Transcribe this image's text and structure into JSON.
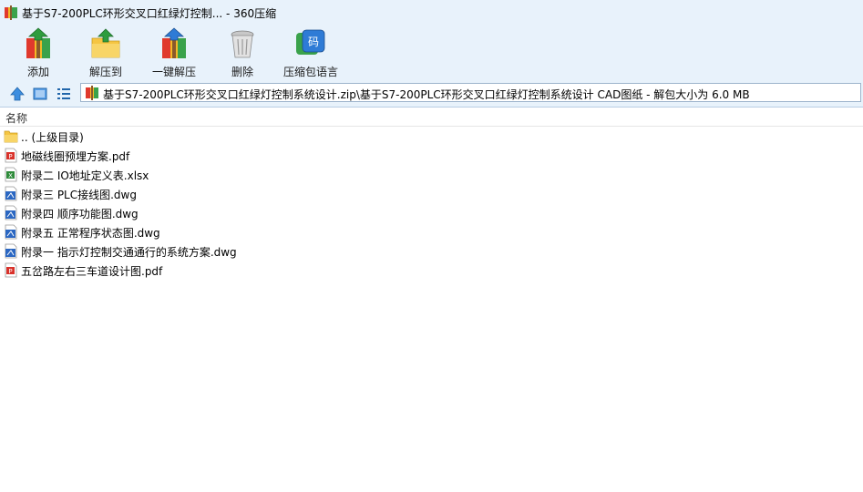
{
  "window": {
    "title": "基于S7-200PLC环形交叉口红绿灯控制... - 360压缩"
  },
  "toolbar": {
    "buttons": [
      {
        "label": "添加",
        "icon": "add-archive-icon"
      },
      {
        "label": "解压到",
        "icon": "extract-to-icon"
      },
      {
        "label": "一键解压",
        "icon": "one-click-extract-icon"
      },
      {
        "label": "删除",
        "icon": "delete-trash-icon"
      },
      {
        "label": "压缩包语言",
        "icon": "archive-language-icon"
      }
    ]
  },
  "nav": {
    "address": "基于S7-200PLC环形交叉口红绿灯控制系统设计.zip\\基于S7-200PLC环形交叉口红绿灯控制系统设计 CAD图纸 - 解包大小为 6.0 MB"
  },
  "list": {
    "column_name": "名称",
    "items": [
      {
        "name": ".. (上级目录)",
        "type": "folder"
      },
      {
        "name": "地磁线圈预埋方案.pdf",
        "type": "pdf"
      },
      {
        "name": "附录二 IO地址定义表.xlsx",
        "type": "xlsx"
      },
      {
        "name": "附录三 PLC接线图.dwg",
        "type": "dwg"
      },
      {
        "name": "附录四 顺序功能图.dwg",
        "type": "dwg"
      },
      {
        "name": "附录五 正常程序状态图.dwg",
        "type": "dwg"
      },
      {
        "name": "附录一 指示灯控制交通通行的系统方案.dwg",
        "type": "dwg"
      },
      {
        "name": "五岔路左右三车道设计图.pdf",
        "type": "pdf"
      }
    ]
  },
  "colors": {
    "chrome_bg": "#e8f2fb",
    "pdf_red": "#d9322b",
    "xlsx_green": "#2e8b3a",
    "dwg_blue": "#2b67c2",
    "folder_yellow": "#f5c542"
  }
}
